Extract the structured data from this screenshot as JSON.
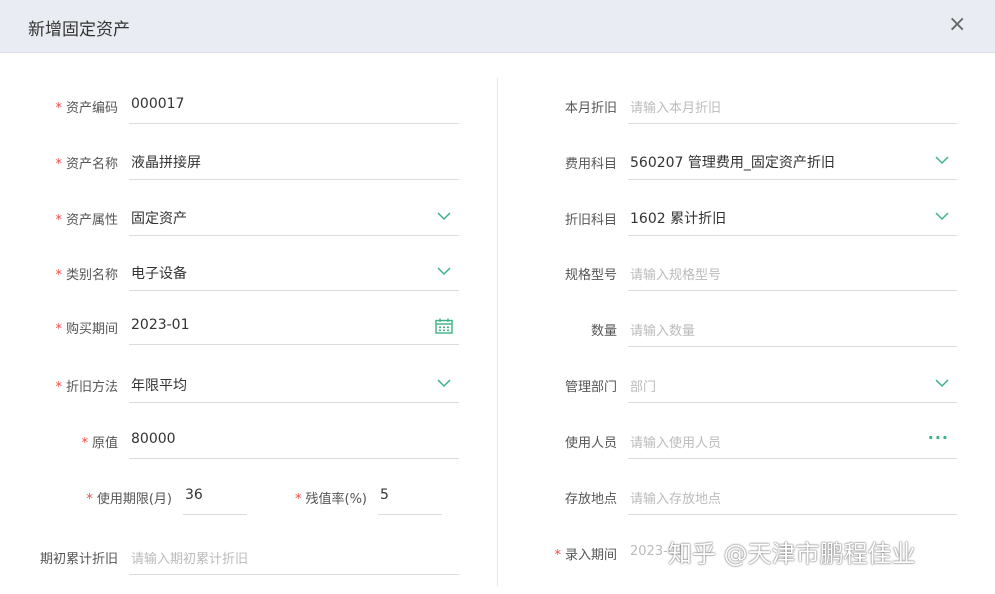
{
  "dialog": {
    "title": "新增固定资产",
    "close": "×"
  },
  "left": {
    "asset_code": {
      "label": "资产编码",
      "value": "000017"
    },
    "asset_name": {
      "label": "资产名称",
      "value": "液晶拼接屏"
    },
    "asset_attr": {
      "label": "资产属性",
      "value": "固定资产"
    },
    "category": {
      "label": "类别名称",
      "value": "电子设备"
    },
    "purchase_period": {
      "label": "购买期间",
      "value": "2023-01"
    },
    "dep_method": {
      "label": "折旧方法",
      "value": "年限平均"
    },
    "original_value": {
      "label": "原值",
      "value": "80000"
    },
    "life": {
      "label": "使用期限(月)",
      "value": "36"
    },
    "residual": {
      "label": "残值率(%)",
      "value": "5"
    },
    "initial_acc_dep": {
      "label": "期初累计折旧",
      "placeholder": "请输入期初累计折旧"
    }
  },
  "right": {
    "month_dep": {
      "label": "本月折旧",
      "placeholder": "请输入本月折旧"
    },
    "expense_subject": {
      "label": "费用科目",
      "value": "560207 管理费用_固定资产折旧"
    },
    "dep_subject": {
      "label": "折旧科目",
      "value": "1602 累计折旧"
    },
    "spec": {
      "label": "规格型号",
      "placeholder": "请输入规格型号"
    },
    "quantity": {
      "label": "数量",
      "placeholder": "请输入数量"
    },
    "dept": {
      "label": "管理部门",
      "placeholder": "部门"
    },
    "user": {
      "label": "使用人员",
      "placeholder": "请输入使用人员",
      "more": "···"
    },
    "location": {
      "label": "存放地点",
      "placeholder": "请输入存放地点"
    },
    "entry_period": {
      "label": "录入期间",
      "value": "2023-01"
    }
  },
  "required_mark": "*",
  "watermark": "知乎 @天津市鹏程佳业",
  "colors": {
    "accent": "#3db383",
    "required": "#f04848",
    "header_bg": "#e9edf3"
  }
}
